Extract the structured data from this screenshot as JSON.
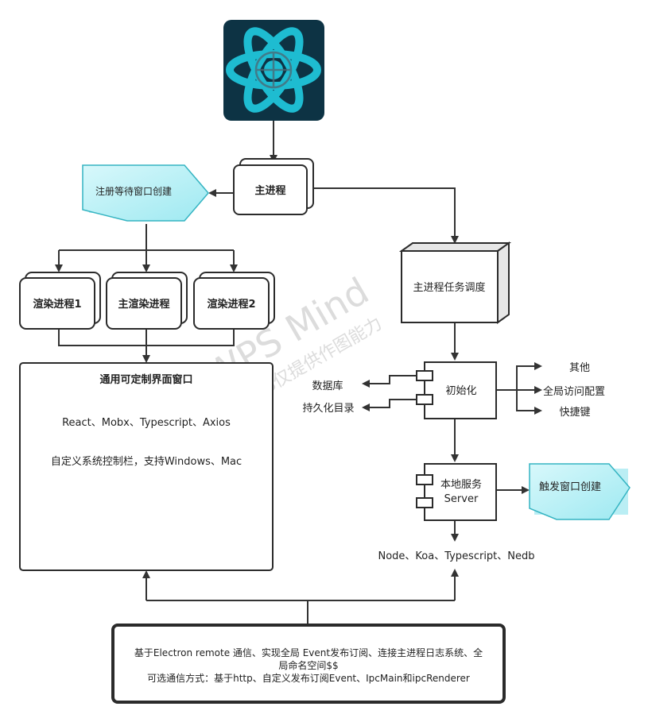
{
  "watermark": {
    "title": "WPS Mind",
    "subtitle": "WPS仅提供作图能力"
  },
  "nodes": {
    "main_process": "主进程",
    "register_wait": "注册等待窗口创建",
    "render_process_1": "渲染进程1",
    "main_render_process": "主渲染进程",
    "render_process_2": "渲染进程2",
    "general_window": {
      "title": "通用可定制界面窗口",
      "tech": "React、Mobx、Typescript、Axios",
      "feature": "自定义系统控制栏，支持Windows、Mac"
    },
    "task_scheduler": "主进程任务调度",
    "init": "初始化",
    "database": "数据库",
    "persist_dir": "持久化目录",
    "other": "其他",
    "global_config": "全局访问配置",
    "shortcut": "快捷键",
    "local_server_line1": "本地服务",
    "local_server_line2": "Server",
    "trigger_window": "触发窗口创建",
    "server_tech": "Node、Koa、Typescript、Nedb",
    "bottom_box": {
      "line1": "基于Electron remote 通信、实现全局 Event发布订阅、连接主进程日志系统、全",
      "line2": "局命名空间$$",
      "line3": "可选通信方式：基于http、自定义发布订阅Event、IpcMain和ipcRenderer"
    }
  },
  "colors": {
    "logo_bg": "#0d3344",
    "logo_accent": "#1ebcd1",
    "callout_fill": "#c4f3f8",
    "callout_stroke": "#35b4c2",
    "box_stroke": "#2b2b2b",
    "task_top": "#e6e6e6"
  }
}
